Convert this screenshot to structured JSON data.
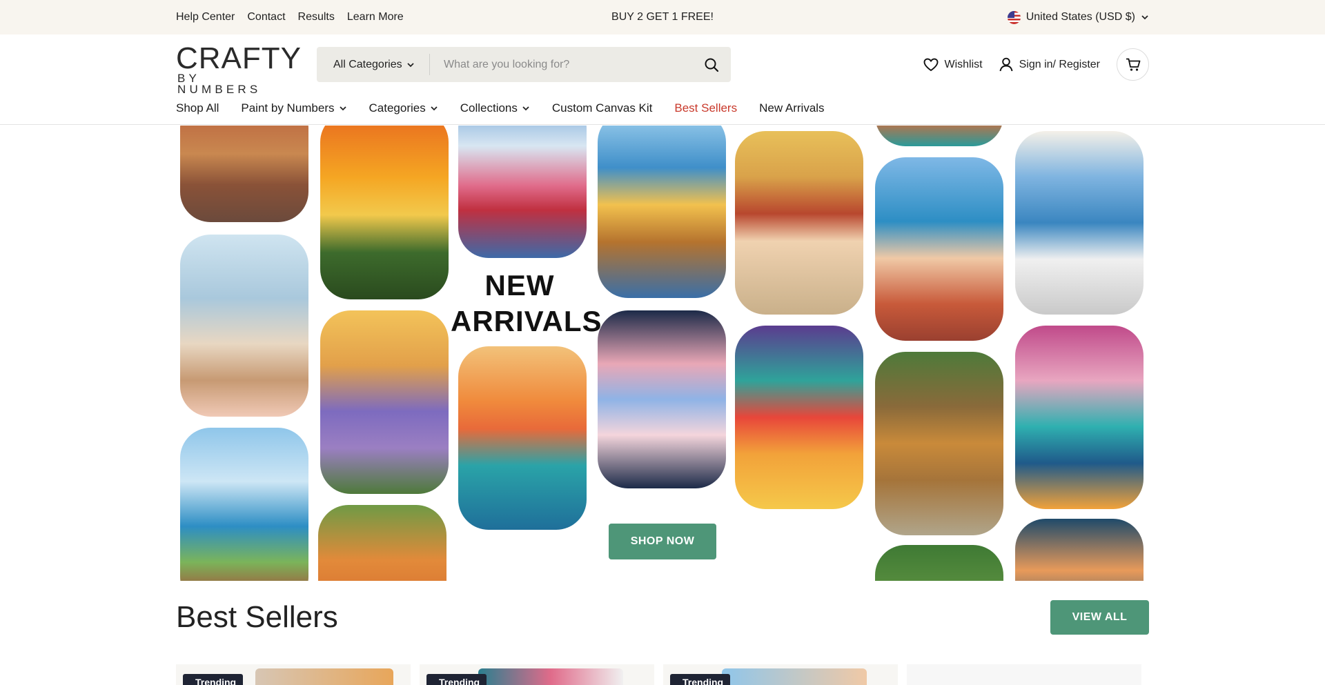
{
  "topbar": {
    "links": [
      "Help Center",
      "Contact",
      "Results",
      "Learn More"
    ],
    "promo": "BUY 2 GET 1 FREE!",
    "locale": "United States (USD $)"
  },
  "brand": {
    "line1": "CRAFTY",
    "line2": "BY NUMBERS"
  },
  "search": {
    "category": "All Categories",
    "placeholder": "What are you looking for?"
  },
  "header": {
    "wishlist": "Wishlist",
    "signin": "Sign in/ Register"
  },
  "nav": [
    "Shop All",
    "Paint by Numbers",
    "Categories",
    "Collections",
    "Custom Canvas Kit",
    "Best Sellers",
    "New Arrivals"
  ],
  "hero": {
    "title_line1": "NEW",
    "title_line2": "ARRIVALS",
    "cta": "SHOP NOW"
  },
  "best_sellers": {
    "title": "Best Sellers",
    "view_all": "VIEW ALL",
    "badges": [
      "Trending",
      "Trending",
      "Trending"
    ]
  },
  "colors": {
    "accent": "#4e9678",
    "sale_red": "#c9392b",
    "topbar_bg": "#f8f5ef",
    "badge_bg": "#1f2434"
  }
}
